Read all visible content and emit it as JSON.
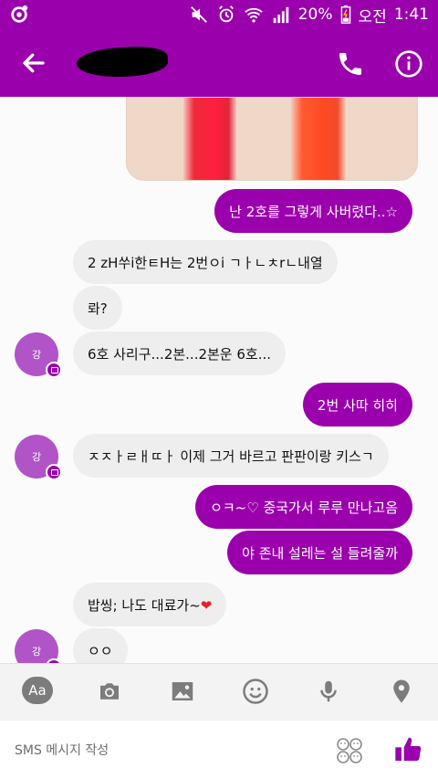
{
  "status_bar": {
    "battery": "20%",
    "ampm": "오전",
    "time": "1:41"
  },
  "header": {
    "contact_name_redacted": ""
  },
  "messages": [
    {
      "side": "out",
      "text": "난 2호를 그렇게 사버렸다..☆"
    },
    {
      "side": "in",
      "text": "2 zH쑤i한ㅌH는 2번ㅇi ㄱㅏㄴㅊrㄴ내열"
    },
    {
      "side": "in",
      "text": "롸?"
    },
    {
      "side": "in",
      "text": "6호 사리구...2본...2본운 6호..."
    },
    {
      "side": "out",
      "text": "2번 사따 히히"
    },
    {
      "side": "in",
      "text": "ㅈㅈㅏㄹㅐㄸㅏ 이제 그거 바르고 판판이랑 키스ㄱ"
    },
    {
      "side": "out",
      "text": "ㅇㅋ~♡ 중국가서 루루 만나고옴"
    },
    {
      "side": "out",
      "text": "야 존내 설레는 설 들려줄까"
    },
    {
      "side": "in",
      "text": "밥씽; 나도 대료가~❤"
    },
    {
      "side": "in",
      "text": "ㅇㅇ"
    }
  ],
  "avatar": {
    "label": "강"
  },
  "toolbar": {
    "text_style_label": "Aa"
  },
  "composer": {
    "placeholder": "SMS 메시지 작성"
  },
  "colors": {
    "brand_purple": "#9b00ad",
    "avatar_purple": "#b054c7",
    "incoming_bubble": "#eeeeee",
    "heart_red": "#e0242a"
  },
  "icons": {
    "status_left": "messenger-icon",
    "back": "arrow-left-icon",
    "call": "phone-icon",
    "info": "info-icon",
    "camera": "camera-icon",
    "gallery": "image-icon",
    "sticker": "smiley-icon",
    "voice": "microphone-icon",
    "location": "location-pin-icon",
    "emoji": "emoji-icon",
    "send_like": "thumbs-up-icon"
  }
}
